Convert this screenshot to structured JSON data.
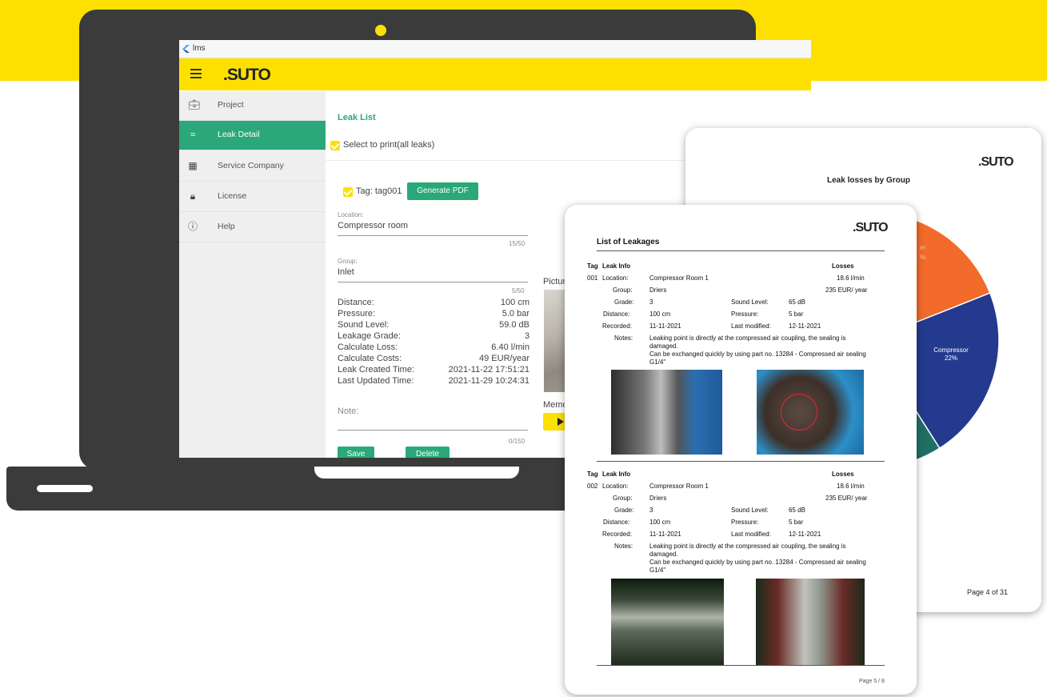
{
  "window": {
    "title": "lms"
  },
  "brand": {
    "logo": ".SUTO"
  },
  "sidebar": {
    "items": [
      {
        "label": "Project",
        "icon": "briefcase-icon"
      },
      {
        "label": "Leak Detail",
        "icon": "leak-icon"
      },
      {
        "label": "Service Company",
        "icon": "building-icon"
      },
      {
        "label": "License",
        "icon": "lock-icon"
      },
      {
        "label": "Help",
        "icon": "help-icon"
      }
    ]
  },
  "leak_list": {
    "title": "Leak List",
    "select_all": "Select to print(all leaks)",
    "tag": "Tag: tag001",
    "generate_pdf": "Generate PDF",
    "location_label": "Location:",
    "location_value": "Compressor room",
    "location_counter": "15/50",
    "group_label": "Group:",
    "group_value": "Inlet",
    "group_counter": "5/50",
    "details": [
      {
        "label": "Distance:",
        "value": "100 cm"
      },
      {
        "label": "Pressure:",
        "value": "5.0 bar"
      },
      {
        "label": "Sound Level:",
        "value": "59.0 dB"
      },
      {
        "label": "Leakage Grade:",
        "value": "3"
      },
      {
        "label": "Calculate Loss:",
        "value": "6.40 l/min"
      },
      {
        "label": "Calculate Costs:",
        "value": "49 EUR/year"
      },
      {
        "label": "Leak Created Time:",
        "value": "2021-11-22 17:51:21"
      },
      {
        "label": "Last Updated Time:",
        "value": "2021-11-29 10:24:31"
      }
    ],
    "note_label": "Note:",
    "note_counter": "0/150",
    "picture_label": "Picture 1",
    "memo_label": "Memo 1",
    "save": "Save",
    "delete": "Delete"
  },
  "report_back": {
    "logo": ".SUTO",
    "chart_title": "Leak losses by Group",
    "page": "Page 4 of 31"
  },
  "chart_data": {
    "type": "pie",
    "title": "Leak losses by Group",
    "slices": [
      {
        "label": "Compressor",
        "value": 22,
        "color": "#243a8e"
      },
      {
        "label": "",
        "value": 19,
        "color": "#f26b2a"
      },
      {
        "label": "",
        "value": 6,
        "color": "#1f6f63"
      },
      {
        "label": "",
        "value": 53,
        "color": "#2a3d95"
      }
    ],
    "visible_labels": [
      "Compressor",
      "22%",
      "er",
      "%"
    ]
  },
  "report_front": {
    "logo": ".SUTO",
    "title": "List of Leakages",
    "col_tag": "Tag",
    "col_info": "Leak Info",
    "col_losses": "Losses",
    "entries": [
      {
        "tag": "001",
        "location_label": "Location:",
        "location": "Compressor Room 1",
        "group_label": "Group:",
        "group": "Driers",
        "grade_label": "Grade:",
        "grade": "3",
        "sound_label": "Sound Level:",
        "sound": "65 dB",
        "distance_label": "Distance:",
        "distance": "100 cm",
        "pressure_label": "Pressure:",
        "pressure": "5 bar",
        "recorded_label": "Recorded:",
        "recorded": "11-11-2021",
        "modified_label": "Last modified:",
        "modified": "12-11-2021",
        "notes_label": "Notes:",
        "notes_1": "Leaking point is directly at the compressed air coupling, the sealing is",
        "notes_2": "damaged.",
        "notes_3": "Can be exchanged quickly by using part no. 13284 - Compressed air sealing",
        "notes_4": "G1/4\"",
        "loss_flow": "18.6  l/min",
        "loss_cost": "235  EUR/ year"
      },
      {
        "tag": "002",
        "location_label": "Location:",
        "location": "Compressor Room 1",
        "group_label": "Group:",
        "group": "Driers",
        "grade_label": "Grade:",
        "grade": "3",
        "sound_label": "Sound Level:",
        "sound": "65 dB",
        "distance_label": "Distance:",
        "distance": "100 cm",
        "pressure_label": "Pressure:",
        "pressure": "5 bar",
        "recorded_label": "Recorded:",
        "recorded": "11-11-2021",
        "modified_label": "Last modified:",
        "modified": "12-11-2021",
        "notes_label": "Notes:",
        "notes_1": "Leaking point is directly at the compressed air coupling, the sealing is",
        "notes_2": "damaged.",
        "notes_3": "Can be exchanged quickly by using part no. 13284 - Compressed air sealing",
        "notes_4": "G1/4\"",
        "loss_flow": "18.6  l/min",
        "loss_cost": "235  EUR/ year"
      }
    ],
    "page": "Page 5 / 8"
  },
  "colors": {
    "brand_yellow": "#fde000",
    "accent_green": "#2aa87a",
    "laptop": "#3b3b3b"
  }
}
